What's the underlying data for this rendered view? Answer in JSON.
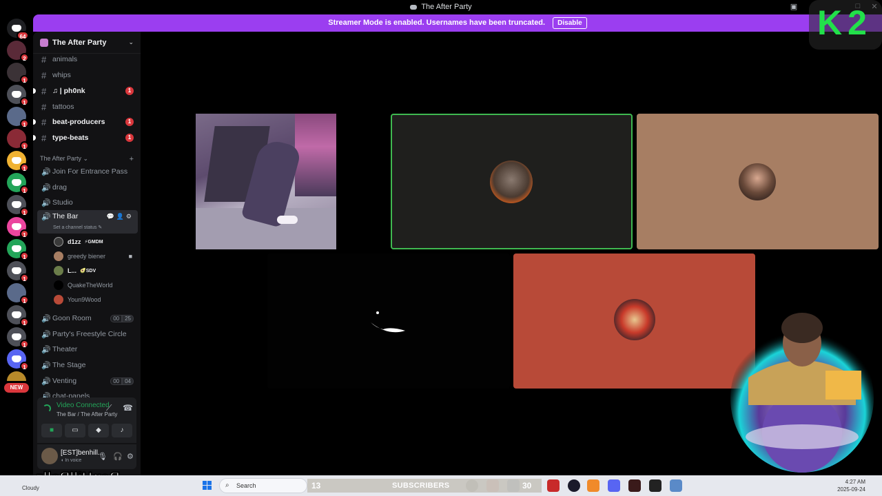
{
  "window": {
    "title": "The After Party"
  },
  "banner": {
    "message": "Streamer Mode is enabled. Usernames have been truncated.",
    "disable_label": "Disable"
  },
  "rail": {
    "home_badge": "64",
    "badges": [
      "2",
      "1",
      "1",
      "1",
      "1",
      "1",
      "1",
      "1",
      "1",
      "1",
      "1",
      "1",
      "1",
      "1",
      "1",
      "1"
    ],
    "new_label": "NEW"
  },
  "server": {
    "name": "The After Party",
    "text_channels": [
      {
        "name": "animals",
        "unread": false
      },
      {
        "name": "whips",
        "unread": false
      },
      {
        "name": "♫ | ph0nk",
        "unread": true,
        "mentions": "1"
      },
      {
        "name": "tattoos",
        "unread": false
      },
      {
        "name": "beat-producers",
        "unread": true,
        "mentions": "1"
      },
      {
        "name": "type-beats",
        "unread": true,
        "mentions": "1"
      }
    ],
    "category": "The After Party",
    "voice_channels": [
      {
        "name": "Join For Entrance Pass"
      },
      {
        "name": "drag"
      },
      {
        "name": "Studio"
      },
      {
        "name": "The Bar",
        "status": "Set a channel status"
      },
      {
        "name": "Goon Room",
        "count": "00",
        "limit": "25"
      },
      {
        "name": "Party's Freestyle Circle"
      },
      {
        "name": "Theater"
      },
      {
        "name": "The Stage"
      },
      {
        "name": "Venting",
        "count": "00",
        "limit": "04"
      },
      {
        "name": "chat-panels"
      }
    ],
    "members": [
      {
        "name": "d1zz",
        "tag": "⚡GMDM",
        "bright": true
      },
      {
        "name": "greedy biener",
        "tag": "",
        "bright": false,
        "camera": true
      },
      {
        "name": "L...",
        "tag": "🥑SDV",
        "bright": true
      },
      {
        "name": "QuakeTheWorld",
        "tag": "",
        "bright": false
      },
      {
        "name": "Youn9Wood",
        "tag": "",
        "bright": false
      }
    ]
  },
  "voice": {
    "status": "Video Connected",
    "location": "The Bar / The After Party"
  },
  "user": {
    "name": "[EST]benhill...",
    "status": "In voice"
  },
  "overlay": {
    "logo": "K2",
    "mirror_text": "BenHillBallz",
    "subs_count": "13",
    "subs_label": "SUBSCRIBERS",
    "subs_goal": "30"
  },
  "taskbar": {
    "weather": "Cloudy",
    "search_placeholder": "Search",
    "time": "4:27 AM",
    "date": "2025-09-24"
  },
  "colors": {
    "streamer_banner": "#9b3ef0",
    "voice_connected": "#23a559",
    "mention": "#da373c",
    "speaking_border": "#3fb950",
    "k2_logo": "#22e04a"
  }
}
